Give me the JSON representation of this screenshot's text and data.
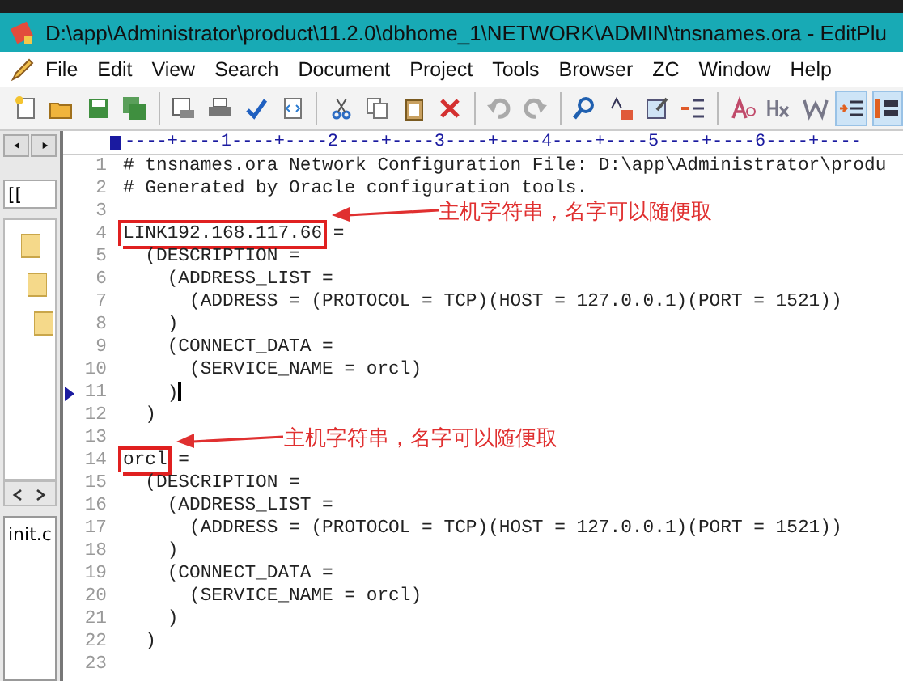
{
  "window": {
    "title": "D:\\app\\Administrator\\product\\11.2.0\\dbhome_1\\NETWORK\\ADMIN\\tnsnames.ora - EditPlu"
  },
  "menu": [
    "File",
    "Edit",
    "View",
    "Search",
    "Document",
    "Project",
    "Tools",
    "Browser",
    "ZC",
    "Window",
    "Help"
  ],
  "toolbar": [
    {
      "kind": "new",
      "pressed": false
    },
    {
      "kind": "open",
      "pressed": false
    },
    {
      "kind": "save",
      "pressed": false
    },
    {
      "kind": "saveall",
      "pressed": false
    },
    {
      "kind": "sep"
    },
    {
      "kind": "preview",
      "pressed": false
    },
    {
      "kind": "print",
      "pressed": false
    },
    {
      "kind": "spell",
      "pressed": false
    },
    {
      "kind": "browser",
      "pressed": false
    },
    {
      "kind": "sep"
    },
    {
      "kind": "cut",
      "pressed": false
    },
    {
      "kind": "copy",
      "pressed": false
    },
    {
      "kind": "paste",
      "pressed": false
    },
    {
      "kind": "delete",
      "pressed": false
    },
    {
      "kind": "sep"
    },
    {
      "kind": "undo",
      "pressed": false
    },
    {
      "kind": "redo",
      "pressed": false
    },
    {
      "kind": "sep"
    },
    {
      "kind": "find",
      "pressed": false
    },
    {
      "kind": "replace",
      "pressed": false
    },
    {
      "kind": "goto",
      "pressed": false
    },
    {
      "kind": "linenum",
      "pressed": false
    },
    {
      "kind": "sep"
    },
    {
      "kind": "font",
      "pressed": false
    },
    {
      "kind": "hex",
      "pressed": false
    },
    {
      "kind": "wrap",
      "pressed": false
    },
    {
      "kind": "indent",
      "pressed": true
    },
    {
      "kind": "column",
      "pressed": true
    }
  ],
  "sidebar": {
    "drive": "[[",
    "tab": "init.c"
  },
  "ruler": "----+----1----+----2----+----3----+----4----+----5----+----6----+----",
  "lines": [
    {
      "number": "1",
      "text": "# tnsnames.ora Network Configuration File: D:\\app\\Administrator\\produ",
      "current": false
    },
    {
      "number": "2",
      "text": "# Generated by Oracle configuration tools.",
      "current": false
    },
    {
      "number": "3",
      "current": false
    },
    {
      "number": "4",
      "text": "LINK192.168.117.66 =",
      "current": false,
      "annotation": "主机字符串，名字可以随便取"
    },
    {
      "number": "5",
      "text": "  (DESCRIPTION =",
      "current": false
    },
    {
      "number": "6",
      "text": "    (ADDRESS_LIST =",
      "current": false
    },
    {
      "number": "7",
      "text": "      (ADDRESS = (PROTOCOL = TCP)(HOST = 127.0.0.1)(PORT = 1521))",
      "current": false
    },
    {
      "number": "8",
      "text": "    )",
      "current": false
    },
    {
      "number": "9",
      "text": "    (CONNECT_DATA =",
      "current": false
    },
    {
      "number": "10",
      "text": "      (SERVICE_NAME = orcl)",
      "current": false
    },
    {
      "number": "11",
      "text": "    )",
      "current": true
    },
    {
      "number": "12",
      "text": "  )",
      "current": false
    },
    {
      "number": "13",
      "current": false
    },
    {
      "number": "14",
      "text": "orcl =",
      "current": false,
      "annotation": "主机字符串，名字可以随便取"
    },
    {
      "number": "15",
      "text": "  (DESCRIPTION =",
      "current": false
    },
    {
      "number": "16",
      "text": "    (ADDRESS_LIST =",
      "current": false
    },
    {
      "number": "17",
      "text": "      (ADDRESS = (PROTOCOL = TCP)(HOST = 127.0.0.1)(PORT = 1521))",
      "current": false
    },
    {
      "number": "18",
      "text": "    )",
      "current": false
    },
    {
      "number": "19",
      "text": "    (CONNECT_DATA =",
      "current": false
    },
    {
      "number": "20",
      "text": "      (SERVICE_NAME = orcl)",
      "current": false
    },
    {
      "number": "21",
      "text": "    )",
      "current": false
    },
    {
      "number": "22",
      "text": "  )",
      "current": false
    },
    {
      "number": "23",
      "current": false
    }
  ]
}
